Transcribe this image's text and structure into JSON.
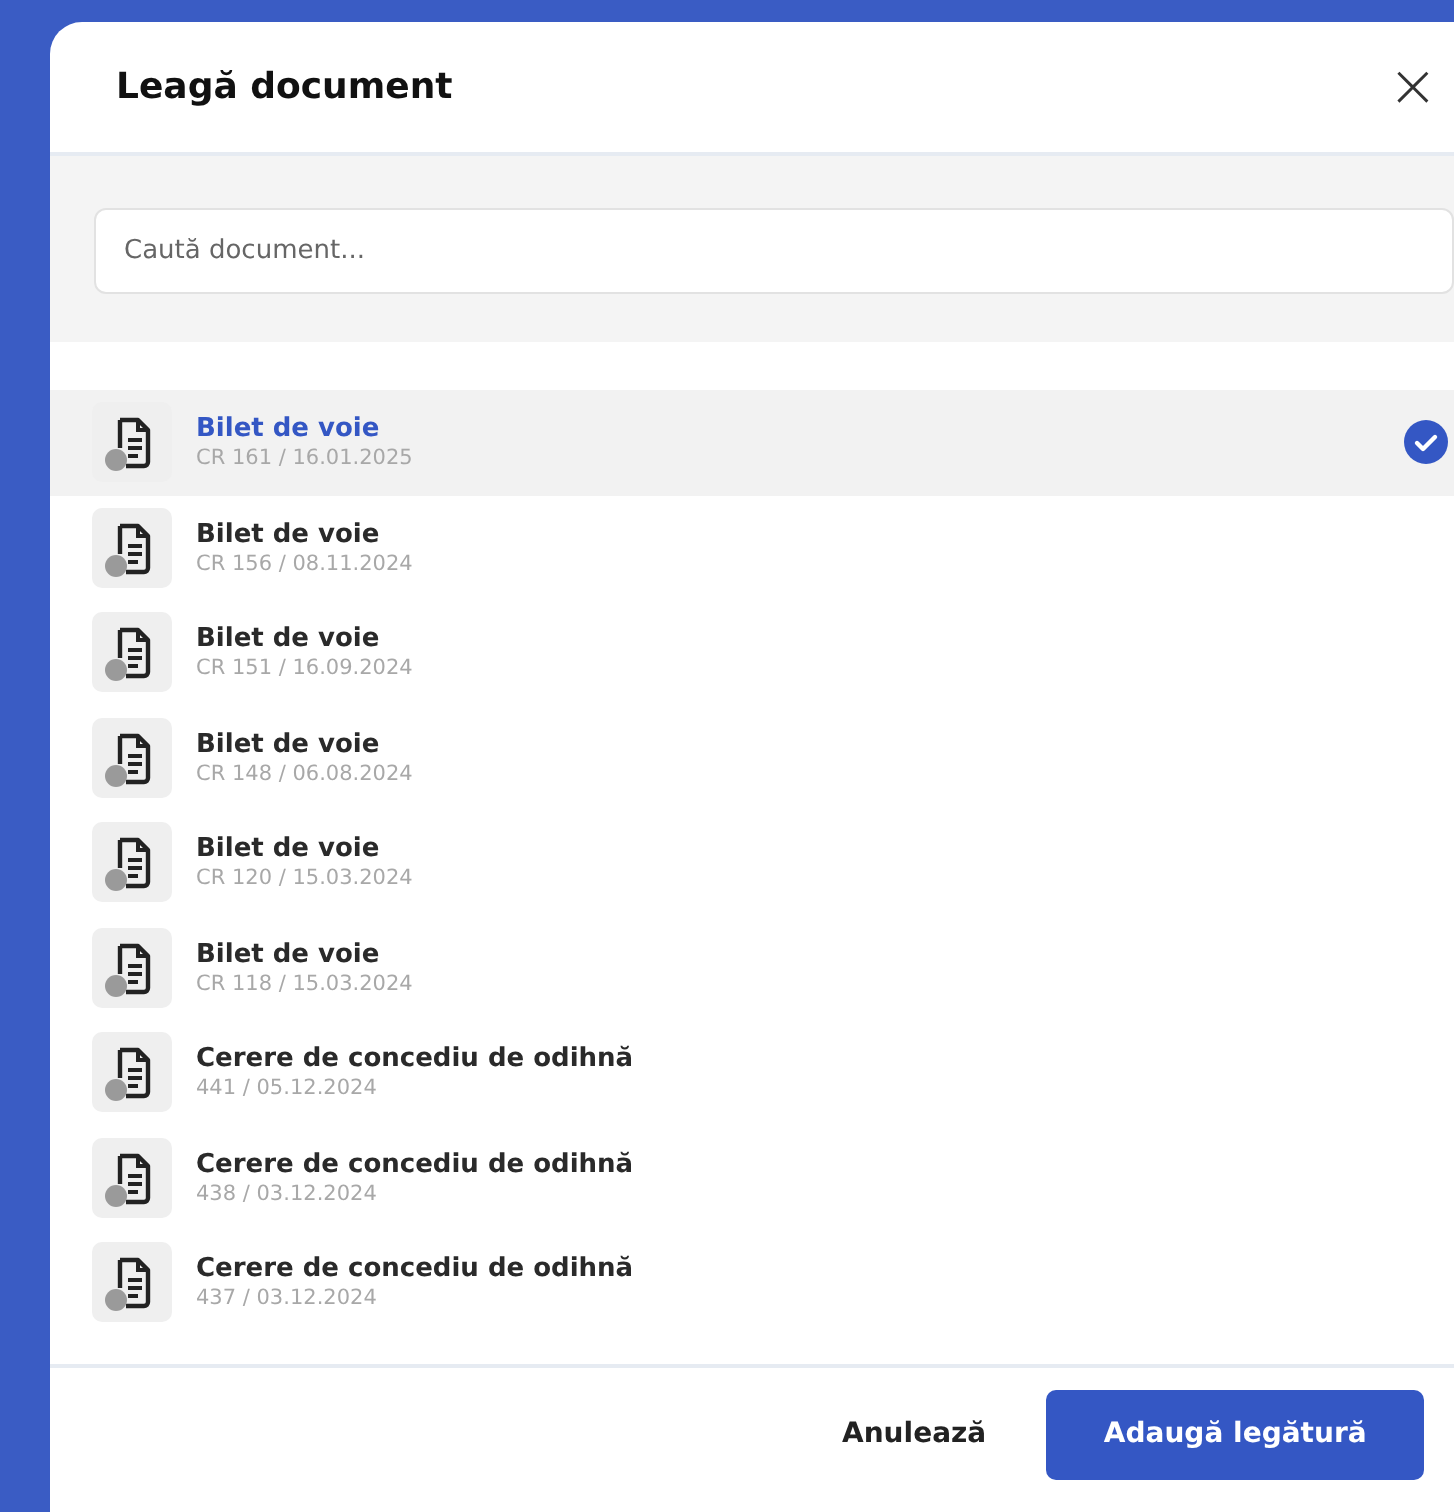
{
  "dialog": {
    "title": "Leagă document",
    "close": "×"
  },
  "search": {
    "placeholder": "Caută document..."
  },
  "documents": [
    {
      "title": "Bilet de voie",
      "meta": "CR 161 / 16.01.2025",
      "selected": true
    },
    {
      "title": "Bilet de voie",
      "meta": "CR 156 / 08.11.2024",
      "selected": false
    },
    {
      "title": "Bilet de voie",
      "meta": "CR 151 / 16.09.2024",
      "selected": false
    },
    {
      "title": "Bilet de voie",
      "meta": "CR 148 / 06.08.2024",
      "selected": false
    },
    {
      "title": "Bilet de voie",
      "meta": "CR 120 / 15.03.2024",
      "selected": false
    },
    {
      "title": "Bilet de voie",
      "meta": "CR 118 / 15.03.2024",
      "selected": false
    },
    {
      "title": "Cerere de concediu de odihnă",
      "meta": "441 / 05.12.2024",
      "selected": false
    },
    {
      "title": "Cerere de concediu de odihnă",
      "meta": "438 / 03.12.2024",
      "selected": false
    },
    {
      "title": "Cerere de concediu de odihnă",
      "meta": "437 / 03.12.2024",
      "selected": false
    }
  ],
  "buttons": [
    {
      "label": "Anulează",
      "kind": "secondary"
    },
    {
      "label": "Adaugă legătură",
      "kind": "primary"
    }
  ]
}
